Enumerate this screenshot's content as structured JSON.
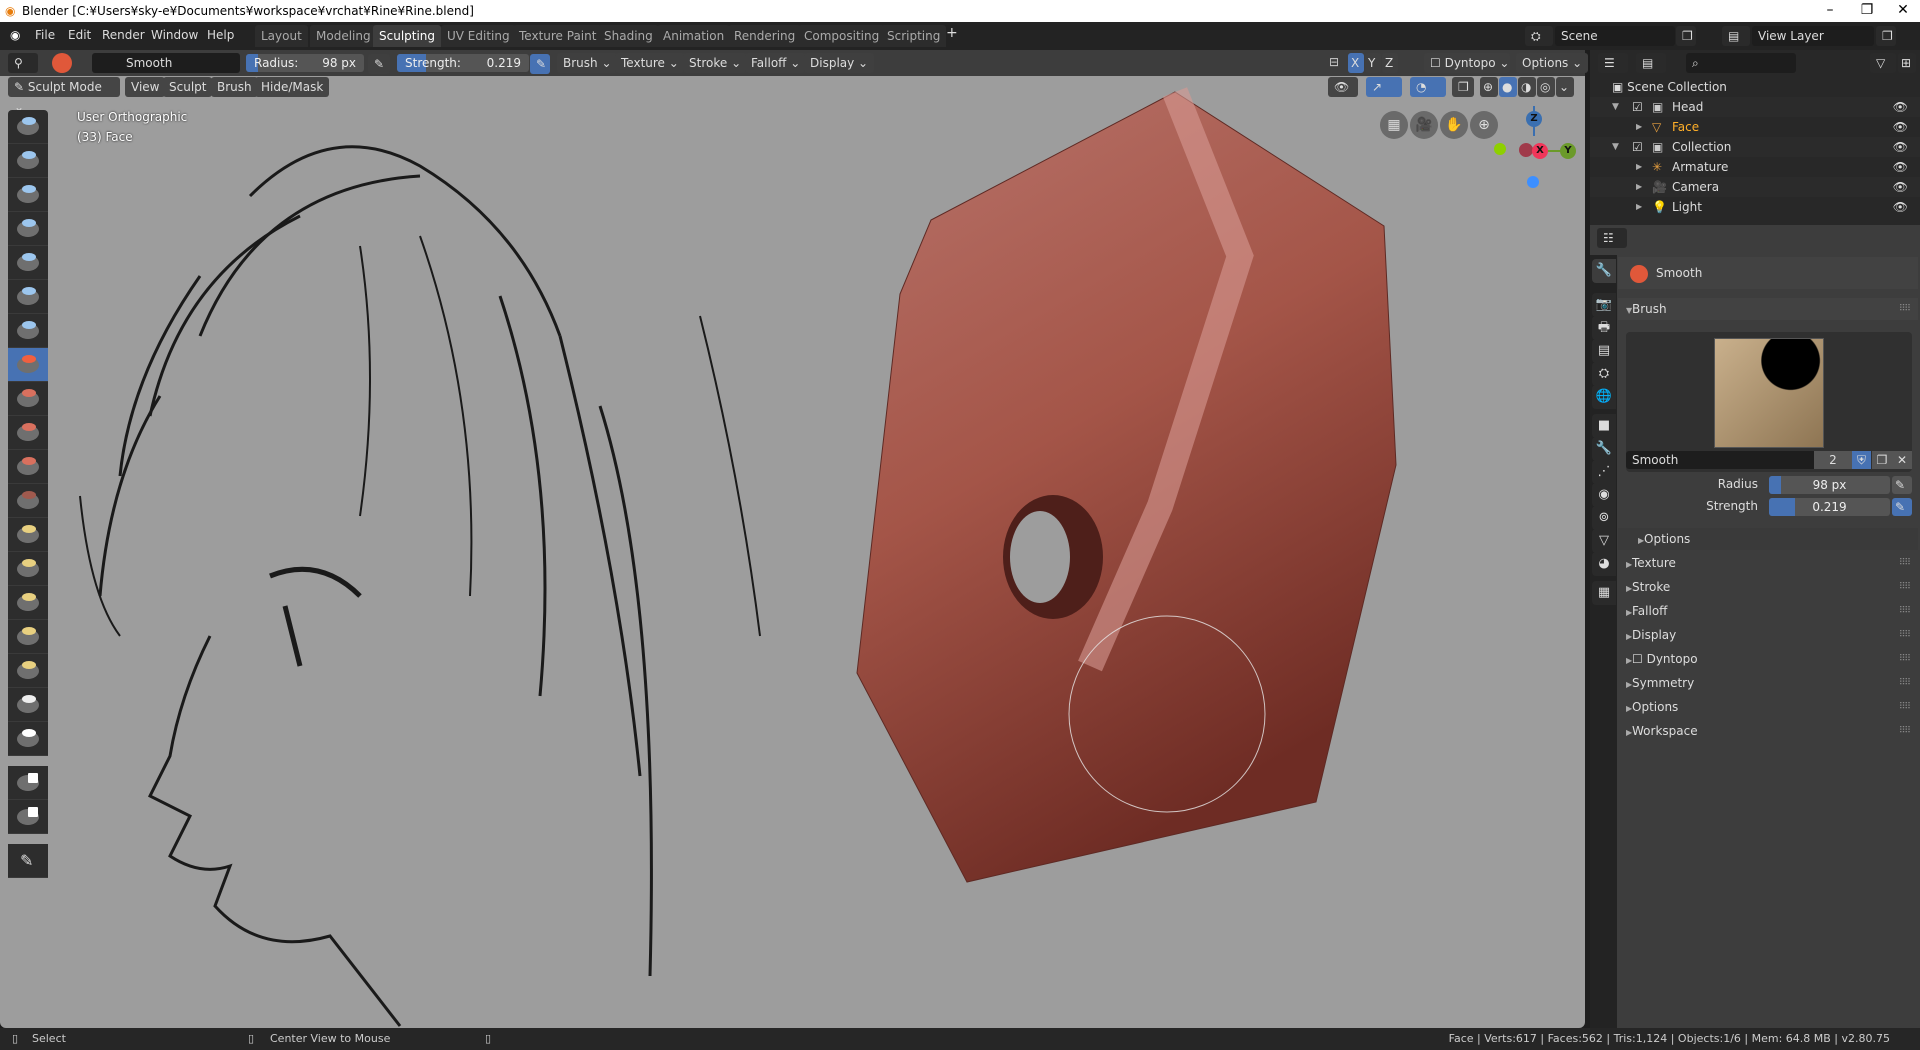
{
  "window": {
    "title": "Blender [C:¥Users¥sky-e¥Documents¥workspace¥vrchat¥Rine¥Rine.blend]"
  },
  "menu": [
    "File",
    "Edit",
    "Render",
    "Window",
    "Help"
  ],
  "workspaces": [
    "Layout",
    "Modeling",
    "Sculpting",
    "UV Editing",
    "Texture Paint",
    "Shading",
    "Animation",
    "Rendering",
    "Compositing",
    "Scripting"
  ],
  "active_workspace": "Sculpting",
  "scene": {
    "name": "Scene",
    "view_layer": "View Layer"
  },
  "tool_header": {
    "brush_name": "Smooth",
    "radius_label": "Radius:",
    "radius_value": "98 px",
    "radius_fraction": 0.1,
    "strength_label": "Strength:",
    "strength_value": "0.219",
    "strength_fraction": 0.219,
    "menus": [
      "Brush",
      "Texture",
      "Stroke",
      "Falloff",
      "Display"
    ],
    "axes": [
      "X",
      "Y",
      "Z"
    ],
    "dyntopo": "Dyntopo",
    "options": "Options"
  },
  "viewport_header": {
    "mode": "Sculpt Mode",
    "menus": [
      "View",
      "Sculpt",
      "Brush",
      "Hide/Mask"
    ]
  },
  "viewport": {
    "view_name": "User Orthographic",
    "object_info": "(33) Face",
    "gizmo_axes": [
      "X",
      "Y",
      "Z"
    ],
    "brush_radius_px": 98,
    "mesh_color": "#a85a50"
  },
  "outliner": {
    "root": "Scene Collection",
    "items": [
      {
        "label": "Head",
        "type": "collection"
      },
      {
        "label": "Face",
        "type": "mesh",
        "active": true
      },
      {
        "label": "Collection",
        "type": "collection"
      },
      {
        "label": "Armature",
        "type": "armature"
      },
      {
        "label": "Camera",
        "type": "camera"
      },
      {
        "label": "Light",
        "type": "light"
      }
    ]
  },
  "properties": {
    "tool_name": "Smooth",
    "brush_panel": "Brush",
    "brush_field": "Smooth",
    "users": "2",
    "radius_label": "Radius",
    "radius_value": "98 px",
    "strength_label": "Strength",
    "strength_value": "0.219",
    "options_sub": "Options",
    "sections": [
      "Texture",
      "Stroke",
      "Falloff",
      "Display",
      "Dyntopo",
      "Symmetry",
      "Options",
      "Workspace"
    ]
  },
  "status": {
    "left": "Select",
    "middle": "Center View to Mouse",
    "right": "Face | Verts:617 | Faces:562 | Tris:1,124 | Objects:1/6 | Mem: 64.8 MB | v2.80.75"
  }
}
